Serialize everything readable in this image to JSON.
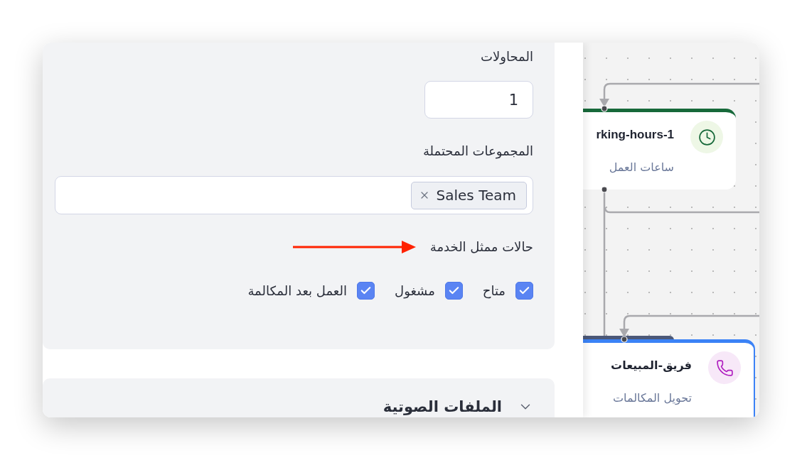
{
  "settings_panel": {
    "attempts": {
      "label": "المحاولات",
      "value": "1"
    },
    "possible_groups": {
      "label": "المجموعات المحتملة",
      "chips": [
        {
          "label": "Sales Team"
        }
      ]
    },
    "agent_states": {
      "label": "حالات ممثل الخدمة",
      "annotation": {
        "kind": "arrow"
      },
      "options": [
        {
          "label": "متاح",
          "checked": true
        },
        {
          "label": "مشغول",
          "checked": true
        },
        {
          "label": "العمل بعد المكالمة",
          "checked": true
        }
      ]
    },
    "audio_files": {
      "title": "الملفات الصوتية",
      "expanded": false
    }
  },
  "flow_canvas": {
    "nodes": [
      {
        "kind": "working_hours",
        "title": "rking-hours-1",
        "subtitle": "ساعات العمل",
        "selected": false
      },
      {
        "kind": "call_transfer",
        "title": "فريق-المبيعات",
        "subtitle": "تحويل المكالمات",
        "selected": true
      }
    ]
  }
}
